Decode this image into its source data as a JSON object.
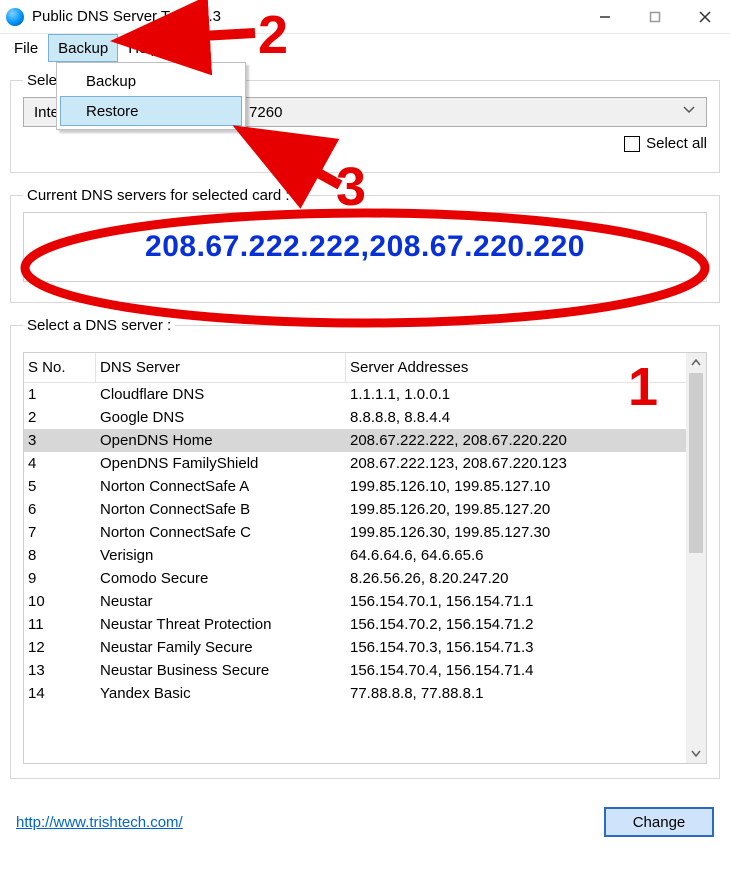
{
  "window": {
    "title": "Public DNS Server Tool v2.3"
  },
  "menu": {
    "file": "File",
    "backup": "Backup",
    "help": "Help",
    "dropdown": {
      "backup": "Backup",
      "restore": "Restore"
    }
  },
  "nic": {
    "legend": "Select Network Interface Card :",
    "selected": "Intel(R) Dual Band Wireless-AC 7260",
    "select_all": "Select all"
  },
  "current": {
    "legend": "Current DNS servers for selected card :",
    "value": "208.67.222.222,208.67.220.220"
  },
  "list": {
    "legend": "Select a DNS server :",
    "columns": {
      "no": "S No.",
      "server": "DNS Server",
      "addr": "Server Addresses"
    },
    "rows": [
      {
        "no": "1",
        "server": "Cloudflare DNS",
        "addr": "1.1.1.1, 1.0.0.1",
        "sel": false
      },
      {
        "no": "2",
        "server": "Google DNS",
        "addr": "8.8.8.8, 8.8.4.4",
        "sel": false
      },
      {
        "no": "3",
        "server": "OpenDNS Home",
        "addr": "208.67.222.222, 208.67.220.220",
        "sel": true
      },
      {
        "no": "4",
        "server": "OpenDNS FamilyShield",
        "addr": "208.67.222.123, 208.67.220.123",
        "sel": false
      },
      {
        "no": "5",
        "server": "Norton ConnectSafe A",
        "addr": "199.85.126.10, 199.85.127.10",
        "sel": false
      },
      {
        "no": "6",
        "server": "Norton ConnectSafe B",
        "addr": "199.85.126.20, 199.85.127.20",
        "sel": false
      },
      {
        "no": "7",
        "server": "Norton ConnectSafe C",
        "addr": "199.85.126.30, 199.85.127.30",
        "sel": false
      },
      {
        "no": "8",
        "server": "Verisign",
        "addr": "64.6.64.6, 64.6.65.6",
        "sel": false
      },
      {
        "no": "9",
        "server": "Comodo Secure",
        "addr": "8.26.56.26, 8.20.247.20",
        "sel": false
      },
      {
        "no": "10",
        "server": "Neustar",
        "addr": "156.154.70.1, 156.154.71.1",
        "sel": false
      },
      {
        "no": "11",
        "server": "Neustar Threat Protection",
        "addr": "156.154.70.2, 156.154.71.2",
        "sel": false
      },
      {
        "no": "12",
        "server": "Neustar Family Secure",
        "addr": "156.154.70.3, 156.154.71.3",
        "sel": false
      },
      {
        "no": "13",
        "server": "Neustar Business Secure",
        "addr": "156.154.70.4, 156.154.71.4",
        "sel": false
      },
      {
        "no": "14",
        "server": "Yandex Basic",
        "addr": "77.88.8.8, 77.88.8.1",
        "sel": false
      }
    ]
  },
  "footer": {
    "link_text": "http://www.trishtech.com/",
    "change": "Change"
  },
  "annotations": {
    "n1": "1",
    "n2": "2",
    "n3": "3"
  }
}
